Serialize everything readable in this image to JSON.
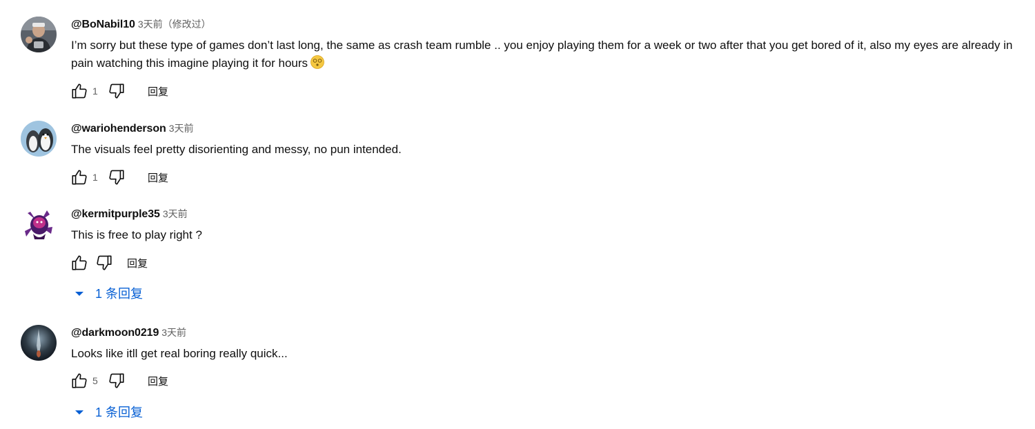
{
  "comments": [
    {
      "author": "@BoNabil10",
      "time": "3天前（修改过）",
      "text": "I’m sorry but these type of games don’t last long, the same as crash team rumble .. you enjoy playing them for a week or two after that you get bored of it, also my eyes are already in pain watching this imagine playing it for hours",
      "emoji": "😵",
      "likes": "1",
      "reply_label": "回复"
    },
    {
      "author": "@wariohenderson",
      "time": "3天前",
      "text": "The visuals feel pretty disorienting and messy, no pun intended.",
      "likes": "1",
      "reply_label": "回复"
    },
    {
      "author": "@kermitpurple35",
      "time": "3天前",
      "text": "This is free to play right ?",
      "likes": "",
      "reply_label": "回复",
      "replies_label": "1 条回复"
    },
    {
      "author": "@darkmoon0219",
      "time": "3天前",
      "text": "Looks like itll get real boring really quick...",
      "likes": "5",
      "reply_label": "回复",
      "replies_label": "1 条回复"
    }
  ],
  "icons": {
    "like": "thumb-up-outline-icon",
    "dislike": "thumb-down-outline-icon",
    "expand": "caret-down-icon"
  },
  "colors": {
    "text": "#0f0f0f",
    "secondary": "#606060",
    "link": "#065fd4"
  }
}
